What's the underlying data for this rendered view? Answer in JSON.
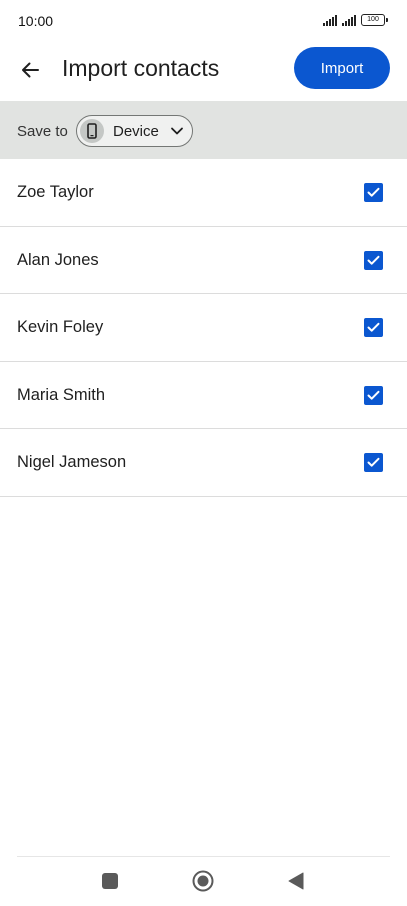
{
  "status_bar": {
    "time": "10:00",
    "battery": "100"
  },
  "header": {
    "title": "Import contacts",
    "import_label": "Import"
  },
  "save_to": {
    "label": "Save to",
    "account": "Device"
  },
  "contacts": [
    {
      "name": "Zoe Taylor",
      "checked": true
    },
    {
      "name": "Alan Jones",
      "checked": true
    },
    {
      "name": "Kevin Foley",
      "checked": true
    },
    {
      "name": "Maria Smith",
      "checked": true
    },
    {
      "name": "Nigel Jameson",
      "checked": true
    }
  ],
  "icons": {
    "back": "arrow-back-icon",
    "device": "phone-icon",
    "chevron": "chevron-down-icon",
    "check": "checkbox-checked-icon",
    "nav_recents": "square-icon",
    "nav_home": "circle-icon",
    "nav_back": "triangle-icon"
  },
  "colors": {
    "accent": "#0b57d0",
    "save_bar_bg": "#e1e3e1"
  }
}
